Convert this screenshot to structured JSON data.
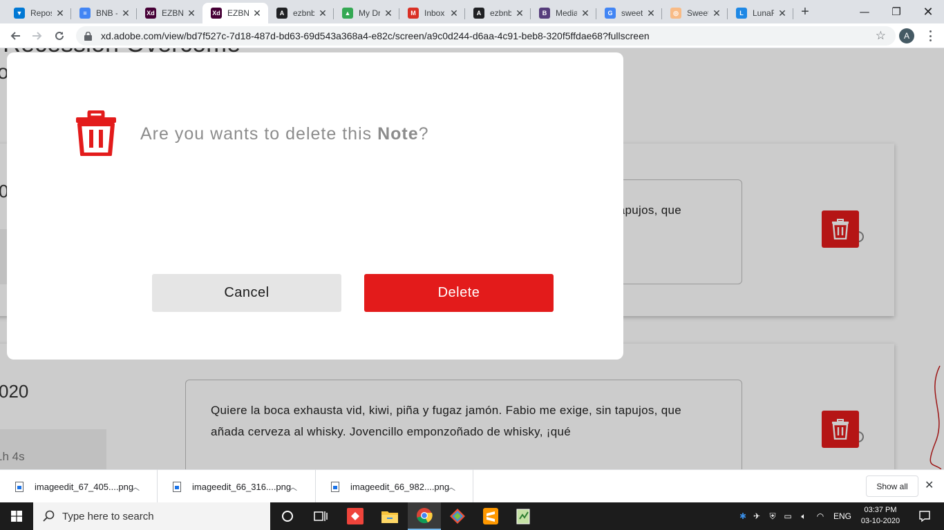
{
  "browser": {
    "tabs": [
      {
        "title": "Repos",
        "favicon": "azure-repos-icon",
        "color": "#0078d4",
        "glyph": "▼"
      },
      {
        "title": "BNB -",
        "favicon": "google-docs-icon",
        "color": "#4285f4",
        "glyph": "≡"
      },
      {
        "title": "EZBN",
        "favicon": "adobe-xd-icon",
        "color": "#470137",
        "glyph": "Xd"
      },
      {
        "title": "EZBN",
        "favicon": "adobe-xd-icon",
        "color": "#470137",
        "glyph": "Xd"
      },
      {
        "title": "ezbnb",
        "favicon": "angular-icon",
        "color": "#202124",
        "glyph": "A"
      },
      {
        "title": "My Dr",
        "favicon": "google-drive-icon",
        "color": "#34a853",
        "glyph": "▲"
      },
      {
        "title": "Inbox",
        "favicon": "gmail-icon",
        "color": "#d93025",
        "glyph": "M"
      },
      {
        "title": "ezbnb",
        "favicon": "angular-icon",
        "color": "#202124",
        "glyph": "A"
      },
      {
        "title": "Media",
        "favicon": "bootstrap-icon",
        "color": "#563d7c",
        "glyph": "B"
      },
      {
        "title": "sweet",
        "favicon": "google-icon",
        "color": "#4285f4",
        "glyph": "G"
      },
      {
        "title": "Sweet",
        "favicon": "sweetalert-icon",
        "color": "#f8bb86",
        "glyph": "◎"
      },
      {
        "title": "LunaF",
        "favicon": "luna-icon",
        "color": "#1e88e5",
        "glyph": "L"
      }
    ],
    "active_tab_index": 3,
    "url": "xd.adobe.com/view/bd7f527c-7d18-487d-bd63-69d543a368a4-e82c/screen/a9c0d244-d6aa-4c91-beb8-320f5ffdae68?fullscreen",
    "profile_initial": "A"
  },
  "page": {
    "heading_fragment": "Recession Overcome",
    "heading_fragment_2": "o",
    "card1": {
      "date_fragment": "0",
      "note_text": "Quiere la boca exhausta vid, kiwi, piña y fugaz jamón. Fabio me exige, sin tapujos, que añada cerveza al whisky. Jovencillo emponzoñado de whisky, ¡qué"
    },
    "card2": {
      "date_fragment": "020",
      "duration": "1h 4s",
      "note_text": "Quiere la boca exhausta vid, kiwi, piña y fugaz jamón. Fabio me exige, sin tapujos, que añada cerveza al whisky. Jovencillo emponzoñado de whisky, ¡qué"
    },
    "accent_color": "#e31b1b"
  },
  "modal": {
    "message_prefix": "Are you wants to delete this ",
    "message_bold": "Note",
    "message_suffix": "?",
    "cancel_label": "Cancel",
    "delete_label": "Delete",
    "icon": "trash-icon"
  },
  "downloads": {
    "items": [
      {
        "name": "imageedit_67_405....png"
      },
      {
        "name": "imageedit_66_316....png"
      },
      {
        "name": "imageedit_66_982....png"
      }
    ],
    "show_all_label": "Show all"
  },
  "taskbar": {
    "search_placeholder": "Type here to search",
    "language": "ENG",
    "time": "03:37 PM",
    "date": "03-10-2020"
  }
}
